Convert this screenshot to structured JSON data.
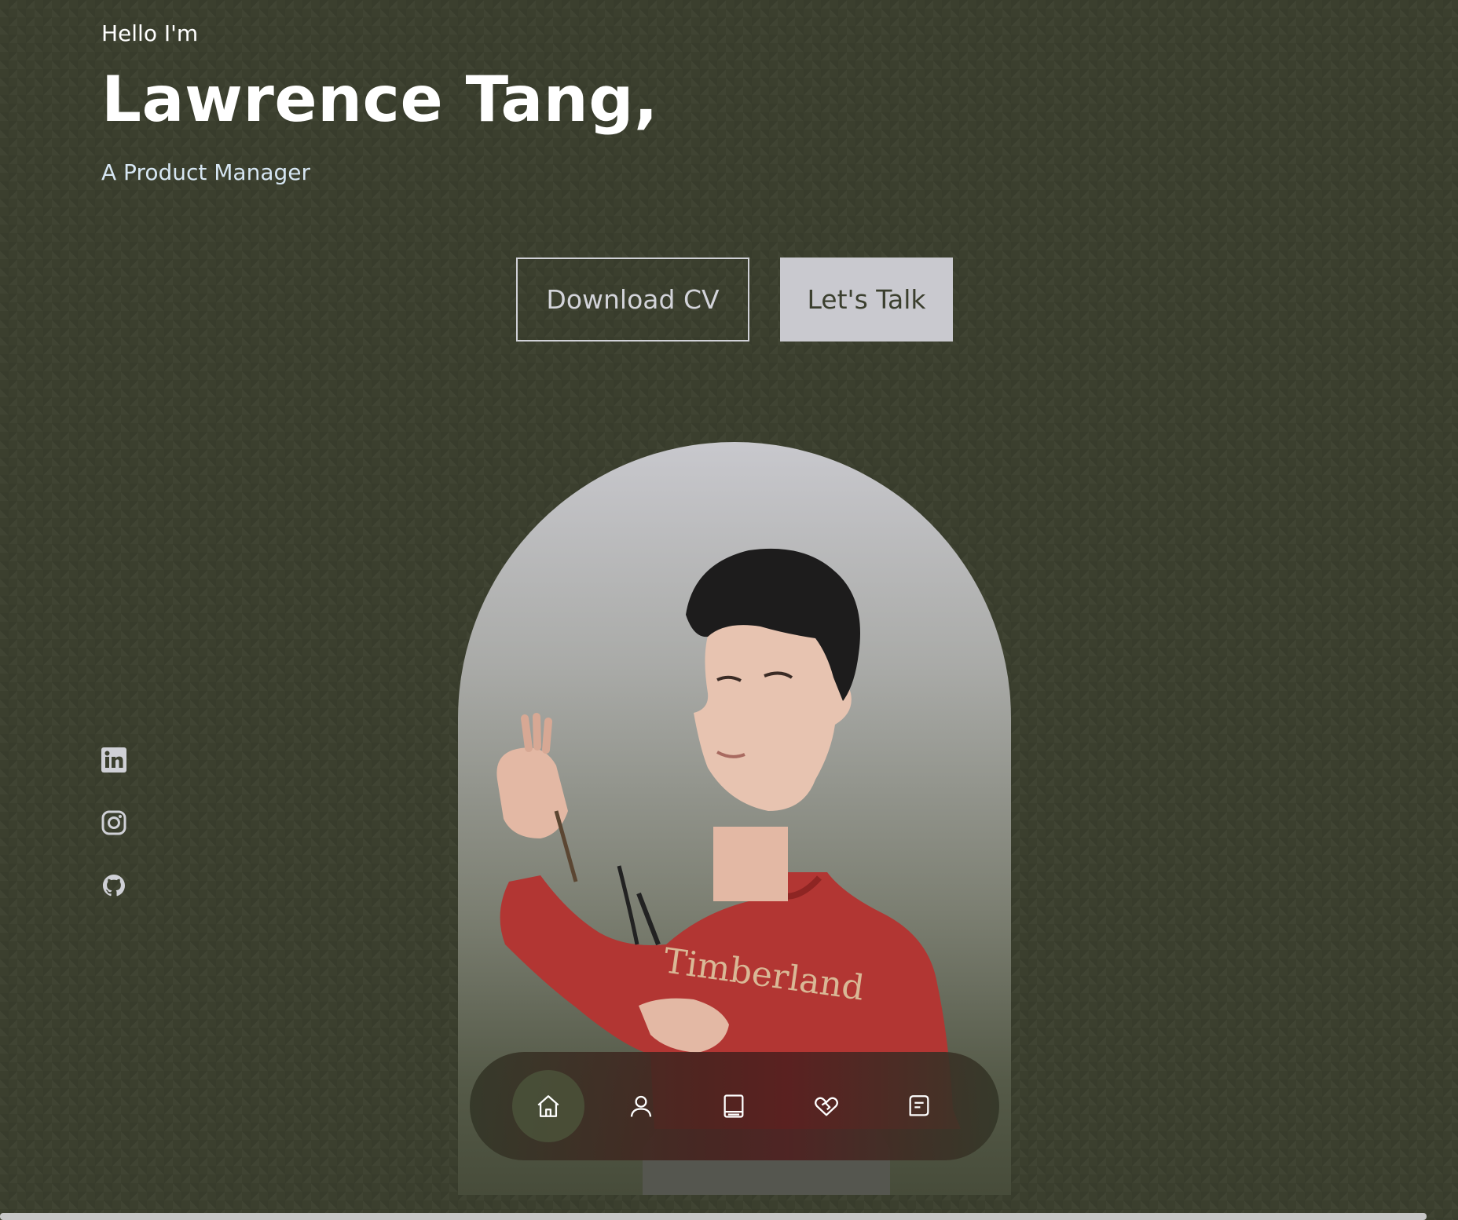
{
  "hero": {
    "greeting": "Hello I'm",
    "name": "Lawrence Tang,",
    "role": "A Product Manager"
  },
  "cta": {
    "download_label": "Download CV",
    "talk_label": "Let's Talk"
  },
  "socials": [
    {
      "icon": "linkedin-icon"
    },
    {
      "icon": "instagram-icon"
    },
    {
      "icon": "github-icon"
    }
  ],
  "nav": {
    "items": [
      {
        "icon": "home-icon",
        "active": true
      },
      {
        "icon": "user-icon",
        "active": false
      },
      {
        "icon": "book-icon",
        "active": false
      },
      {
        "icon": "handshake-heart-icon",
        "active": false
      },
      {
        "icon": "message-icon",
        "active": false
      }
    ]
  },
  "portrait": {
    "shirt_text": "Timberland"
  },
  "colors": {
    "background": "#3b3f2e",
    "accent": "#c9c9cf",
    "role_text": "#d6e6f3",
    "sweater": "#b23633"
  }
}
